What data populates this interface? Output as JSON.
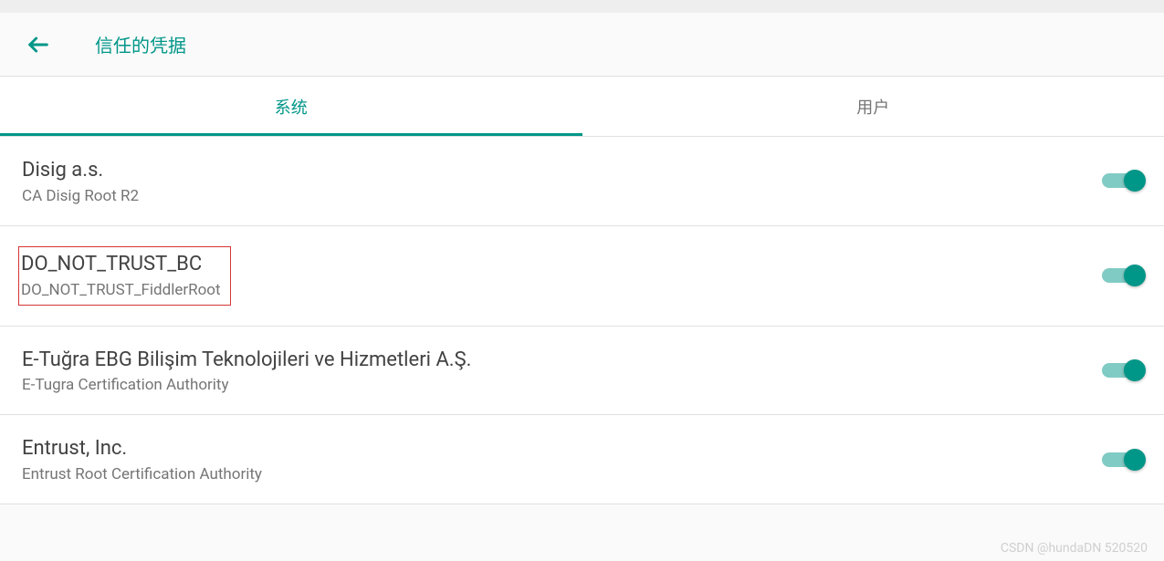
{
  "header": {
    "title": "信任的凭据"
  },
  "tabs": {
    "system": "系统",
    "user": "用户"
  },
  "certificates": [
    {
      "title": "Disig a.s.",
      "subtitle": "CA Disig Root R2",
      "enabled": true,
      "highlighted": false
    },
    {
      "title": "DO_NOT_TRUST_BC",
      "subtitle": "DO_NOT_TRUST_FiddlerRoot",
      "enabled": true,
      "highlighted": true
    },
    {
      "title": "E-Tuğra EBG Bilişim Teknolojileri ve Hizmetleri A.Ş.",
      "subtitle": "E-Tugra Certification Authority",
      "enabled": true,
      "highlighted": false
    },
    {
      "title": "Entrust, Inc.",
      "subtitle": "Entrust Root Certification Authority",
      "enabled": true,
      "highlighted": false
    }
  ],
  "watermark": "CSDN @hundaDN 520520"
}
